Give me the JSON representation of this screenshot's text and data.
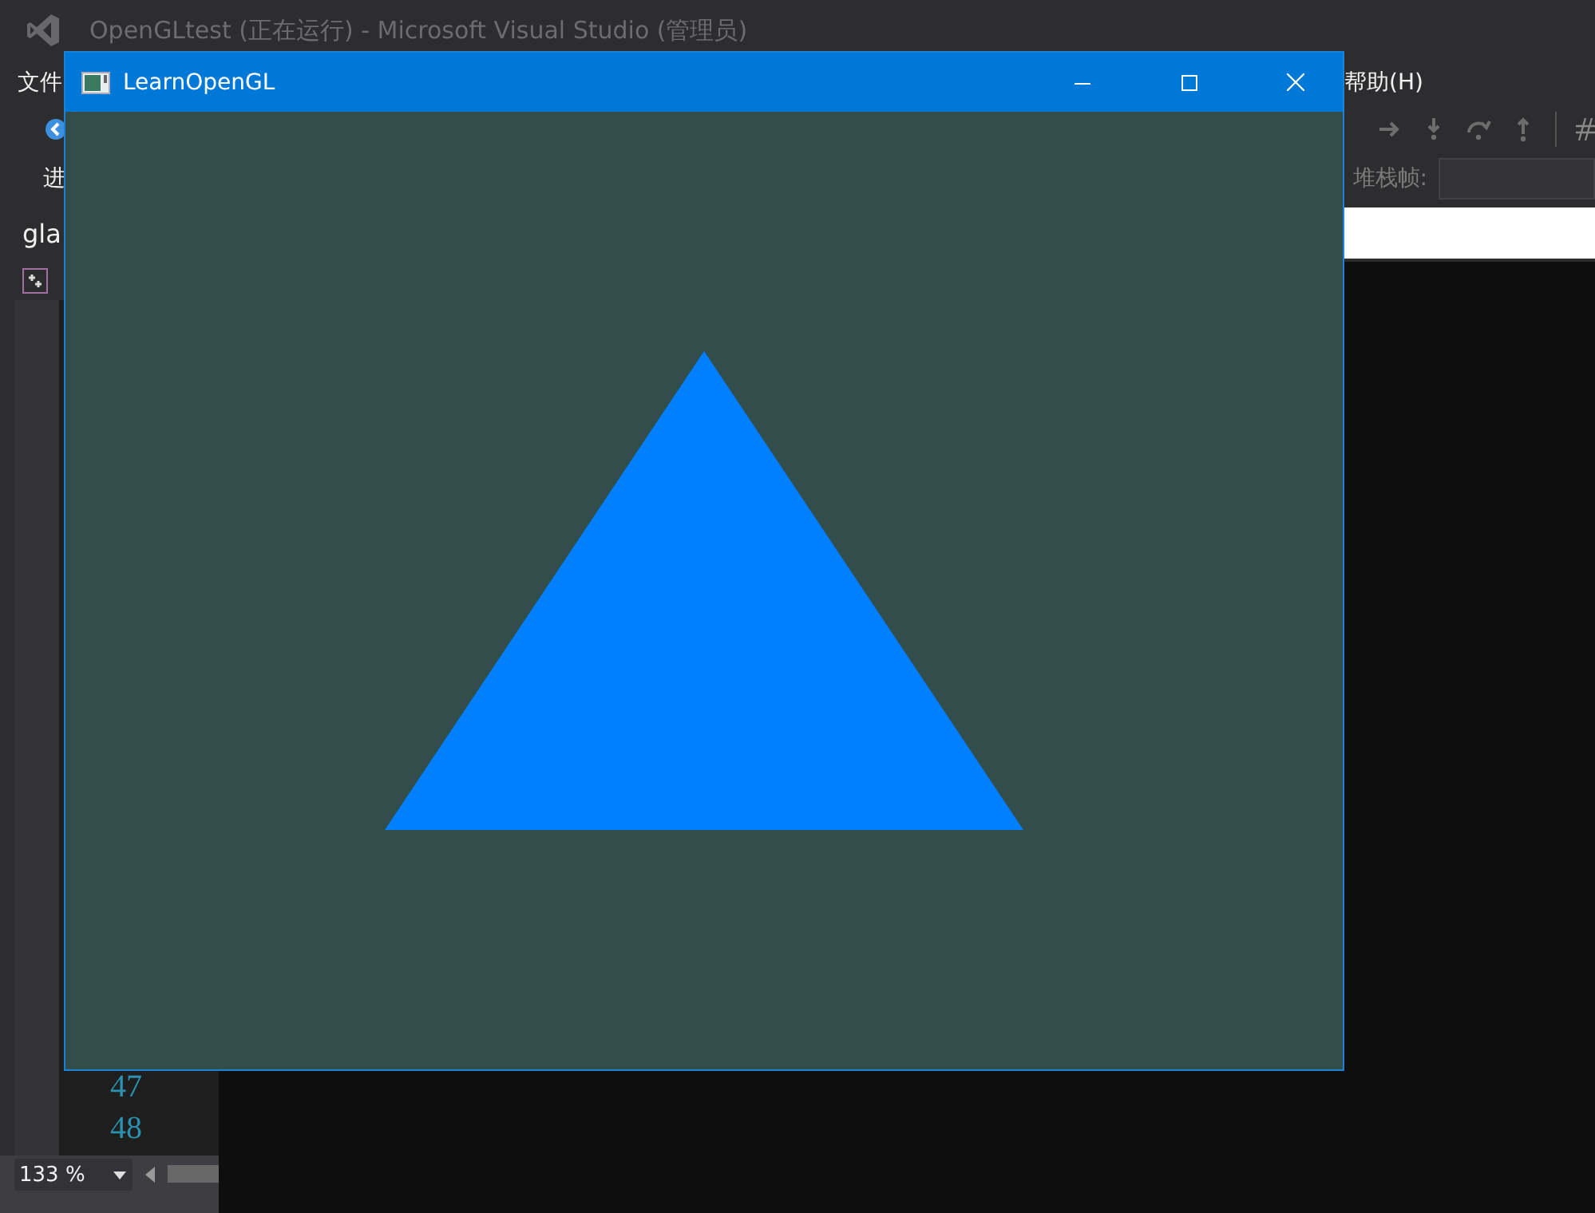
{
  "ide": {
    "title": "OpenGLtest (正在运行) - Microsoft Visual Studio (管理员)",
    "menu": [
      "文件",
      "帮助(H)"
    ],
    "toolbar_label": "进",
    "stack_frame_label": "堆栈帧:",
    "tab": "gla",
    "line_numbers": [
      "47",
      "48"
    ],
    "zoom": "133 %"
  },
  "app_window": {
    "title": "LearnOpenGL",
    "content": {
      "kind": "triangle"
    }
  }
}
